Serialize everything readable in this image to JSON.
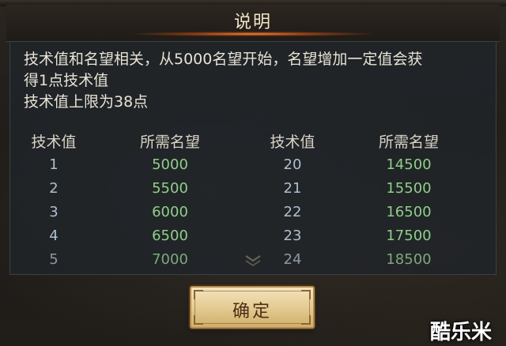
{
  "dialog": {
    "title": "说明",
    "description": {
      "line1": "技术值和名望相关，从5000名望开始，名望增加一定值会获",
      "line2": "得1点技术值",
      "line3": "技术值上限为38点"
    },
    "table": {
      "headers": {
        "col1": "技术值",
        "col2": "所需名望",
        "col3": "技术值",
        "col4": "所需名望"
      },
      "rows": [
        {
          "left_level": "1",
          "left_rep": "5000",
          "right_level": "20",
          "right_rep": "14500"
        },
        {
          "left_level": "2",
          "left_rep": "5500",
          "right_level": "21",
          "right_rep": "15500"
        },
        {
          "left_level": "3",
          "left_rep": "6000",
          "right_level": "22",
          "right_rep": "16500"
        },
        {
          "left_level": "4",
          "left_rep": "6500",
          "right_level": "23",
          "right_rep": "17500"
        },
        {
          "left_level": "5",
          "left_rep": "7000",
          "right_level": "24",
          "right_rep": "18500"
        }
      ]
    },
    "confirm_label": "确定"
  },
  "watermark": "酷乐米",
  "colors": {
    "title_glow": "#ff9a3c",
    "reputation_value": "#8fcf8a",
    "level_value": "#aebfcf",
    "button_face": "#e3c98f",
    "button_text": "#4a2f14"
  },
  "icons": {
    "scroll_indicator": "double-chevron-down-icon"
  }
}
